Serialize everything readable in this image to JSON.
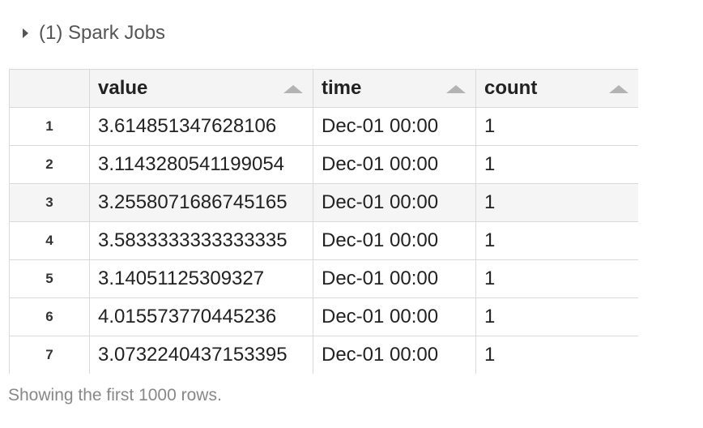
{
  "jobs": {
    "label": "(1) Spark Jobs"
  },
  "table": {
    "columns": [
      "",
      "value",
      "time",
      "count"
    ],
    "sort_icon": "sort-ascending-icon",
    "rows": [
      {
        "index": "1",
        "value": "3.614851347628106",
        "time": "Dec-01 00:00",
        "count": "1"
      },
      {
        "index": "2",
        "value": "3.1143280541199054",
        "time": "Dec-01 00:00",
        "count": "1"
      },
      {
        "index": "3",
        "value": "3.2558071686745165",
        "time": "Dec-01 00:00",
        "count": "1"
      },
      {
        "index": "4",
        "value": "3.5833333333333335",
        "time": "Dec-01 00:00",
        "count": "1"
      },
      {
        "index": "5",
        "value": "3.14051125309327",
        "time": "Dec-01 00:00",
        "count": "1"
      },
      {
        "index": "6",
        "value": "4.015573770445236",
        "time": "Dec-01 00:00",
        "count": "1"
      },
      {
        "index": "7",
        "value": "3.0732240437153395",
        "time": "Dec-01 00:00",
        "count": "1"
      }
    ]
  },
  "footer": {
    "note": "Showing the first 1000 rows."
  }
}
